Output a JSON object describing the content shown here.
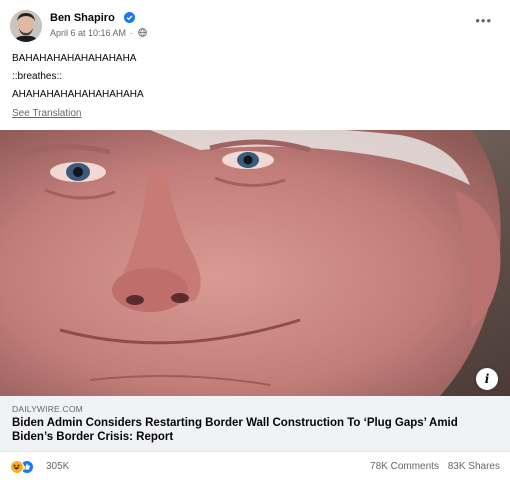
{
  "post": {
    "author": "Ben Shapiro",
    "timestamp": "April 6 at 10:16 AM",
    "separator": "·",
    "more_icon_glyph": "•••",
    "body_lines": [
      "BAHAHAHAHAHAHAHAHA",
      "::breathes::",
      "AHAHAHAHAHAHAHAHAHA"
    ],
    "translation_link": "See Translation"
  },
  "link_preview": {
    "domain": "DAILYWIRE.COM",
    "headline": "Biden Admin Considers Restarting Border Wall Construction To ‘Plug Gaps’ Amid Biden’s Border Crisis: Report",
    "info_glyph": "i"
  },
  "stats": {
    "reaction_count": "305K",
    "comments": "78K Comments",
    "shares": "83K Shares"
  },
  "colors": {
    "accent": "#1877f2",
    "secondary_text": "#65676b",
    "link_card_bg": "#f0f2f5",
    "haha": "#f7b125"
  },
  "icons": {
    "verified": "verified-badge-icon",
    "privacy": "globe-icon",
    "more": "more-options-icon",
    "info": "info-icon",
    "reaction_haha": "haha-reaction-icon",
    "reaction_like": "like-reaction-icon"
  }
}
